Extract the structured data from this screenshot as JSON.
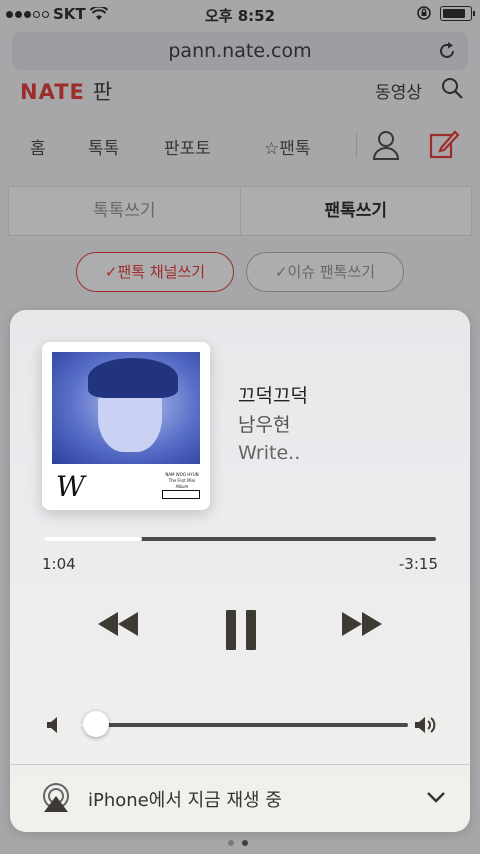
{
  "status_bar": {
    "carrier": "SKT",
    "time": "오후 8:52"
  },
  "browser": {
    "url": "pann.nate.com"
  },
  "site": {
    "logo": "NATE",
    "logo_suffix": "판",
    "video_link": "동영상",
    "nav": [
      "홈",
      "톡톡",
      "판포토",
      "☆팬톡"
    ],
    "tabs": [
      {
        "label": "톡톡쓰기",
        "active": false
      },
      {
        "label": "팬톡쓰기",
        "active": true
      }
    ],
    "pill_primary": "✓팬톡 채널쓰기",
    "pill_secondary": "✓이슈 팬톡쓰기"
  },
  "player": {
    "album_art": {
      "letter": "W",
      "artist_caps": "NAM WOO HYUN",
      "album_caps": "The First Mini Album"
    },
    "song_title": "끄덕끄덕",
    "artist": "남우현",
    "album": "Write..",
    "elapsed": "1:04",
    "remaining": "-3:15",
    "progress_fraction": 0.25,
    "volume_fraction": 0.05,
    "airplay_label": "iPhone에서 지금 재생 중",
    "colors": {
      "accent": "#e2231a",
      "control": "#3d3a33"
    }
  },
  "page_indicator": {
    "count": 2,
    "active": 1
  }
}
